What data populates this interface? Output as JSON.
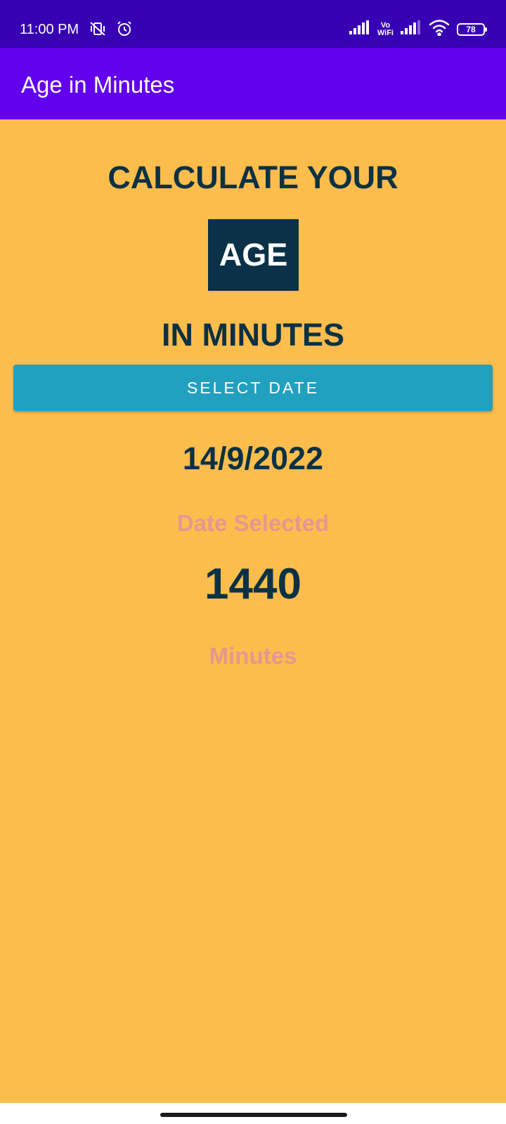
{
  "status_bar": {
    "time": "11:00 PM",
    "left_icons": [
      "vibrate-off-icon",
      "alarm-icon"
    ],
    "right_icons": [
      "signal-icon",
      "vowifi-icon",
      "signal-icon",
      "wifi-icon",
      "battery-icon"
    ],
    "vowifi_top": "Vo",
    "vowifi_bottom": "WiFi",
    "battery": "78"
  },
  "app_bar": {
    "title": "Age in Minutes"
  },
  "main": {
    "heading_top": "CALCULATE YOUR",
    "heading_box": "AGE",
    "heading_bottom": "IN MINUTES",
    "select_button_label": "SELECT DATE",
    "selected_date": "14/9/2022",
    "date_caption": "Date Selected",
    "minutes_value": "1440",
    "minutes_caption": "Minutes"
  },
  "colors": {
    "status_bar": "#3700b3",
    "app_bar": "#6200ee",
    "background": "#fcbd4c",
    "heading_text": "#0c3144",
    "age_box": "#0a3147",
    "button": "#22a0bf",
    "caption_text": "#e3998f"
  }
}
